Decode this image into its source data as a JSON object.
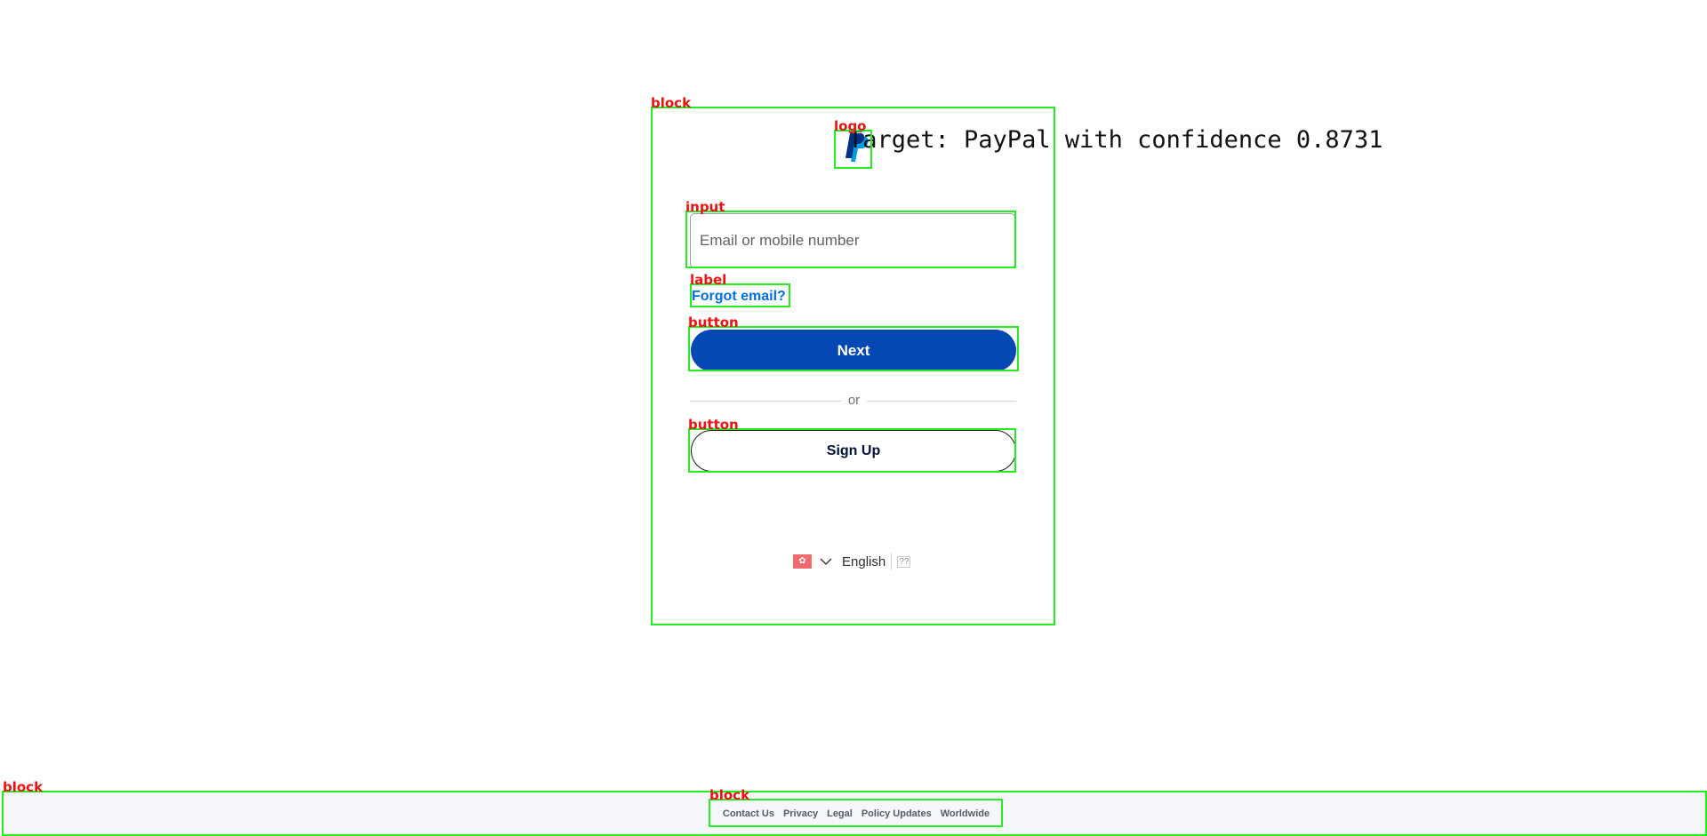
{
  "detection": {
    "target_text": "Target: PayPal with confidence 0.8731",
    "labels": {
      "card": "block",
      "logo": "logo",
      "input": "input",
      "forgot": "label",
      "next": "button",
      "signup": "button",
      "footer": "block",
      "footer_links": "block"
    },
    "box_color": "#22ee22",
    "label_color": "#ee1111"
  },
  "login": {
    "email_placeholder": "Email or mobile number",
    "email_value": "",
    "forgot_label": "Forgot email?",
    "next_label": "Next",
    "divider_label": "or",
    "signup_label": "Sign Up",
    "language": "English",
    "language_alt": "??"
  },
  "footer": {
    "links": [
      "Contact Us",
      "Privacy",
      "Legal",
      "Policy Updates",
      "Worldwide"
    ]
  },
  "icons": {
    "logo": "paypal-logo",
    "flag": "hong-kong-flag-icon",
    "language_dropdown": "chevron-down-icon"
  },
  "colors": {
    "brand_dark": "#003087",
    "brand_light": "#009cde",
    "next_button": "#0547b3",
    "link": "#0070e0",
    "footer_bg": "#f5f7fa"
  }
}
